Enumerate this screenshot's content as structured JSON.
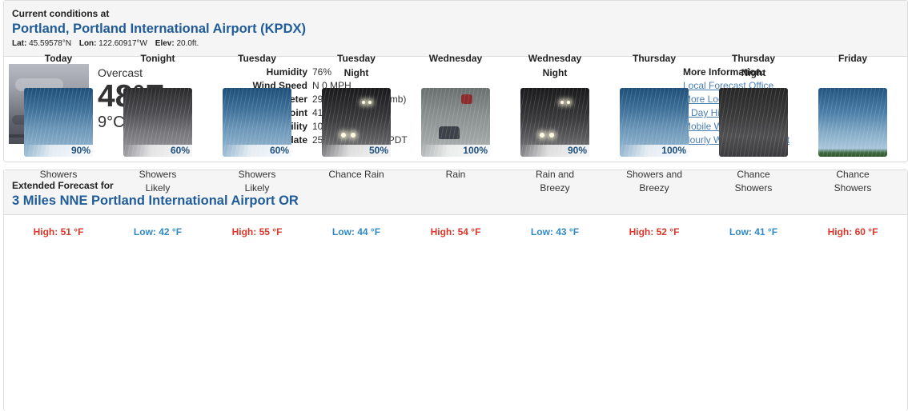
{
  "current": {
    "header_small": "Current conditions at",
    "station": "Portland, Portland International Airport (KPDX)",
    "lat_label": "Lat:",
    "lat": "45.59578°N",
    "lon_label": "Lon:",
    "lon": "122.60917°W",
    "elev_label": "Elev:",
    "elev": "20.0ft.",
    "condition": "Overcast",
    "temp_f": "48°F",
    "temp_c": "9°C",
    "details": [
      {
        "label": "Humidity",
        "value": "76%"
      },
      {
        "label": "Wind Speed",
        "value": "N 0 MPH"
      },
      {
        "label": "Barometer",
        "value": "29.93 in (1013.55 mb)"
      },
      {
        "label": "Dewpoint",
        "value": "41°F (5°C)"
      },
      {
        "label": "Visibility",
        "value": "10.00 mi"
      },
      {
        "label": "Last update",
        "value": "25 Mar 06:53 AM PDT"
      }
    ],
    "more_title": "More Information:",
    "links": [
      "Local Forecast Office",
      "More Local Wx",
      "3 Day History",
      "Mobile Weather",
      "Hourly Weather Forecast"
    ]
  },
  "extended": {
    "header_small": "Extended Forecast for",
    "location": "3 Miles NNE Portland International Airport OR",
    "periods": [
      {
        "name1": "Today",
        "name2": "",
        "icon": "day-showers-icon",
        "pct": "90%",
        "short1": "Showers",
        "short2": "",
        "temp": "High: 51 °F",
        "kind": "high"
      },
      {
        "name1": "Tonight",
        "name2": "",
        "icon": "night-showers-icon",
        "pct": "60%",
        "short1": "Showers",
        "short2": "Likely",
        "temp": "Low: 42 °F",
        "kind": "low"
      },
      {
        "name1": "Tuesday",
        "name2": "",
        "icon": "day-showers-icon",
        "pct": "60%",
        "short1": "Showers",
        "short2": "Likely",
        "temp": "High: 55 °F",
        "kind": "high"
      },
      {
        "name1": "Tuesday",
        "name2": "Night",
        "icon": "night-rain-icon",
        "pct": "50%",
        "short1": "Chance Rain",
        "short2": "",
        "temp": "Low: 44 °F",
        "kind": "low"
      },
      {
        "name1": "Wednesday",
        "name2": "",
        "icon": "day-rain-icon",
        "pct": "100%",
        "short1": "Rain",
        "short2": "",
        "temp": "High: 54 °F",
        "kind": "high"
      },
      {
        "name1": "Wednesday",
        "name2": "Night",
        "icon": "night-rain-wind-icon",
        "pct": "90%",
        "short1": "Rain and",
        "short2": "Breezy",
        "temp": "Low: 43 °F",
        "kind": "low"
      },
      {
        "name1": "Thursday",
        "name2": "",
        "icon": "day-showers-wind-icon",
        "pct": "100%",
        "short1": "Showers and",
        "short2": "Breezy",
        "temp": "High: 52 °F",
        "kind": "high"
      },
      {
        "name1": "Thursday",
        "name2": "Night",
        "icon": "night-chance-showers-icon",
        "pct": "",
        "short1": "Chance",
        "short2": "Showers",
        "temp": "Low: 41 °F",
        "kind": "low"
      },
      {
        "name1": "Friday",
        "name2": "",
        "icon": "day-chance-showers-icon",
        "pct": "",
        "short1": "Chance",
        "short2": "Showers",
        "temp": "High: 60 °F",
        "kind": "high"
      }
    ]
  },
  "colors": {
    "heading_blue": "#1f5c99",
    "link_blue": "#4a7fb5",
    "high_red": "#d9372b",
    "low_blue": "#2f89c5"
  }
}
